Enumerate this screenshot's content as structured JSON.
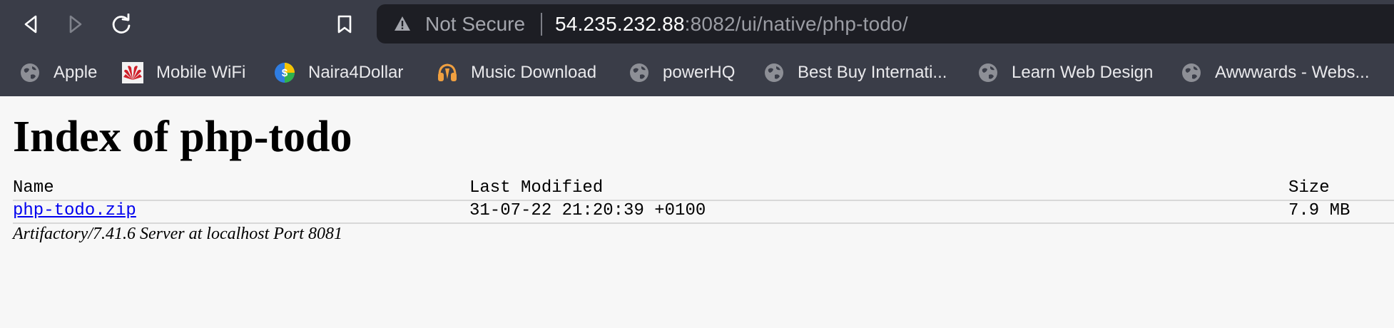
{
  "browser": {
    "security_label": "Not Secure",
    "url_host": "54.235.232.88",
    "url_path": ":8082/ui/native/php-todo/",
    "bookmarks": [
      {
        "label": "Apple",
        "icon": "globe-icon"
      },
      {
        "label": "Mobile WiFi",
        "icon": "huawei-icon"
      },
      {
        "label": "Naira4Dollar",
        "icon": "naira4dollar-icon"
      },
      {
        "label": "Music Download",
        "icon": "music-icon"
      },
      {
        "label": "powerHQ",
        "icon": "globe-icon"
      },
      {
        "label": "Best Buy Internati...",
        "icon": "globe-icon"
      },
      {
        "label": "Learn Web Design",
        "icon": "globe-icon"
      },
      {
        "label": "Awwwards - Webs...",
        "icon": "globe-icon"
      }
    ]
  },
  "page": {
    "title": "Index of php-todo",
    "columns": {
      "name": "Name",
      "last_modified": "Last Modified",
      "size": "Size"
    },
    "files": [
      {
        "name": "php-todo.zip",
        "last_modified": "31-07-22 21:20:39 +0100",
        "size": "7.9 MB"
      }
    ],
    "footer": "Artifactory/7.41.6 Server at localhost Port 8081"
  },
  "colors": {
    "chrome_bg": "#3a3d48",
    "urlbar_bg": "#1d1e24",
    "page_bg": "#f7f7f7",
    "link": "#0000ee"
  }
}
